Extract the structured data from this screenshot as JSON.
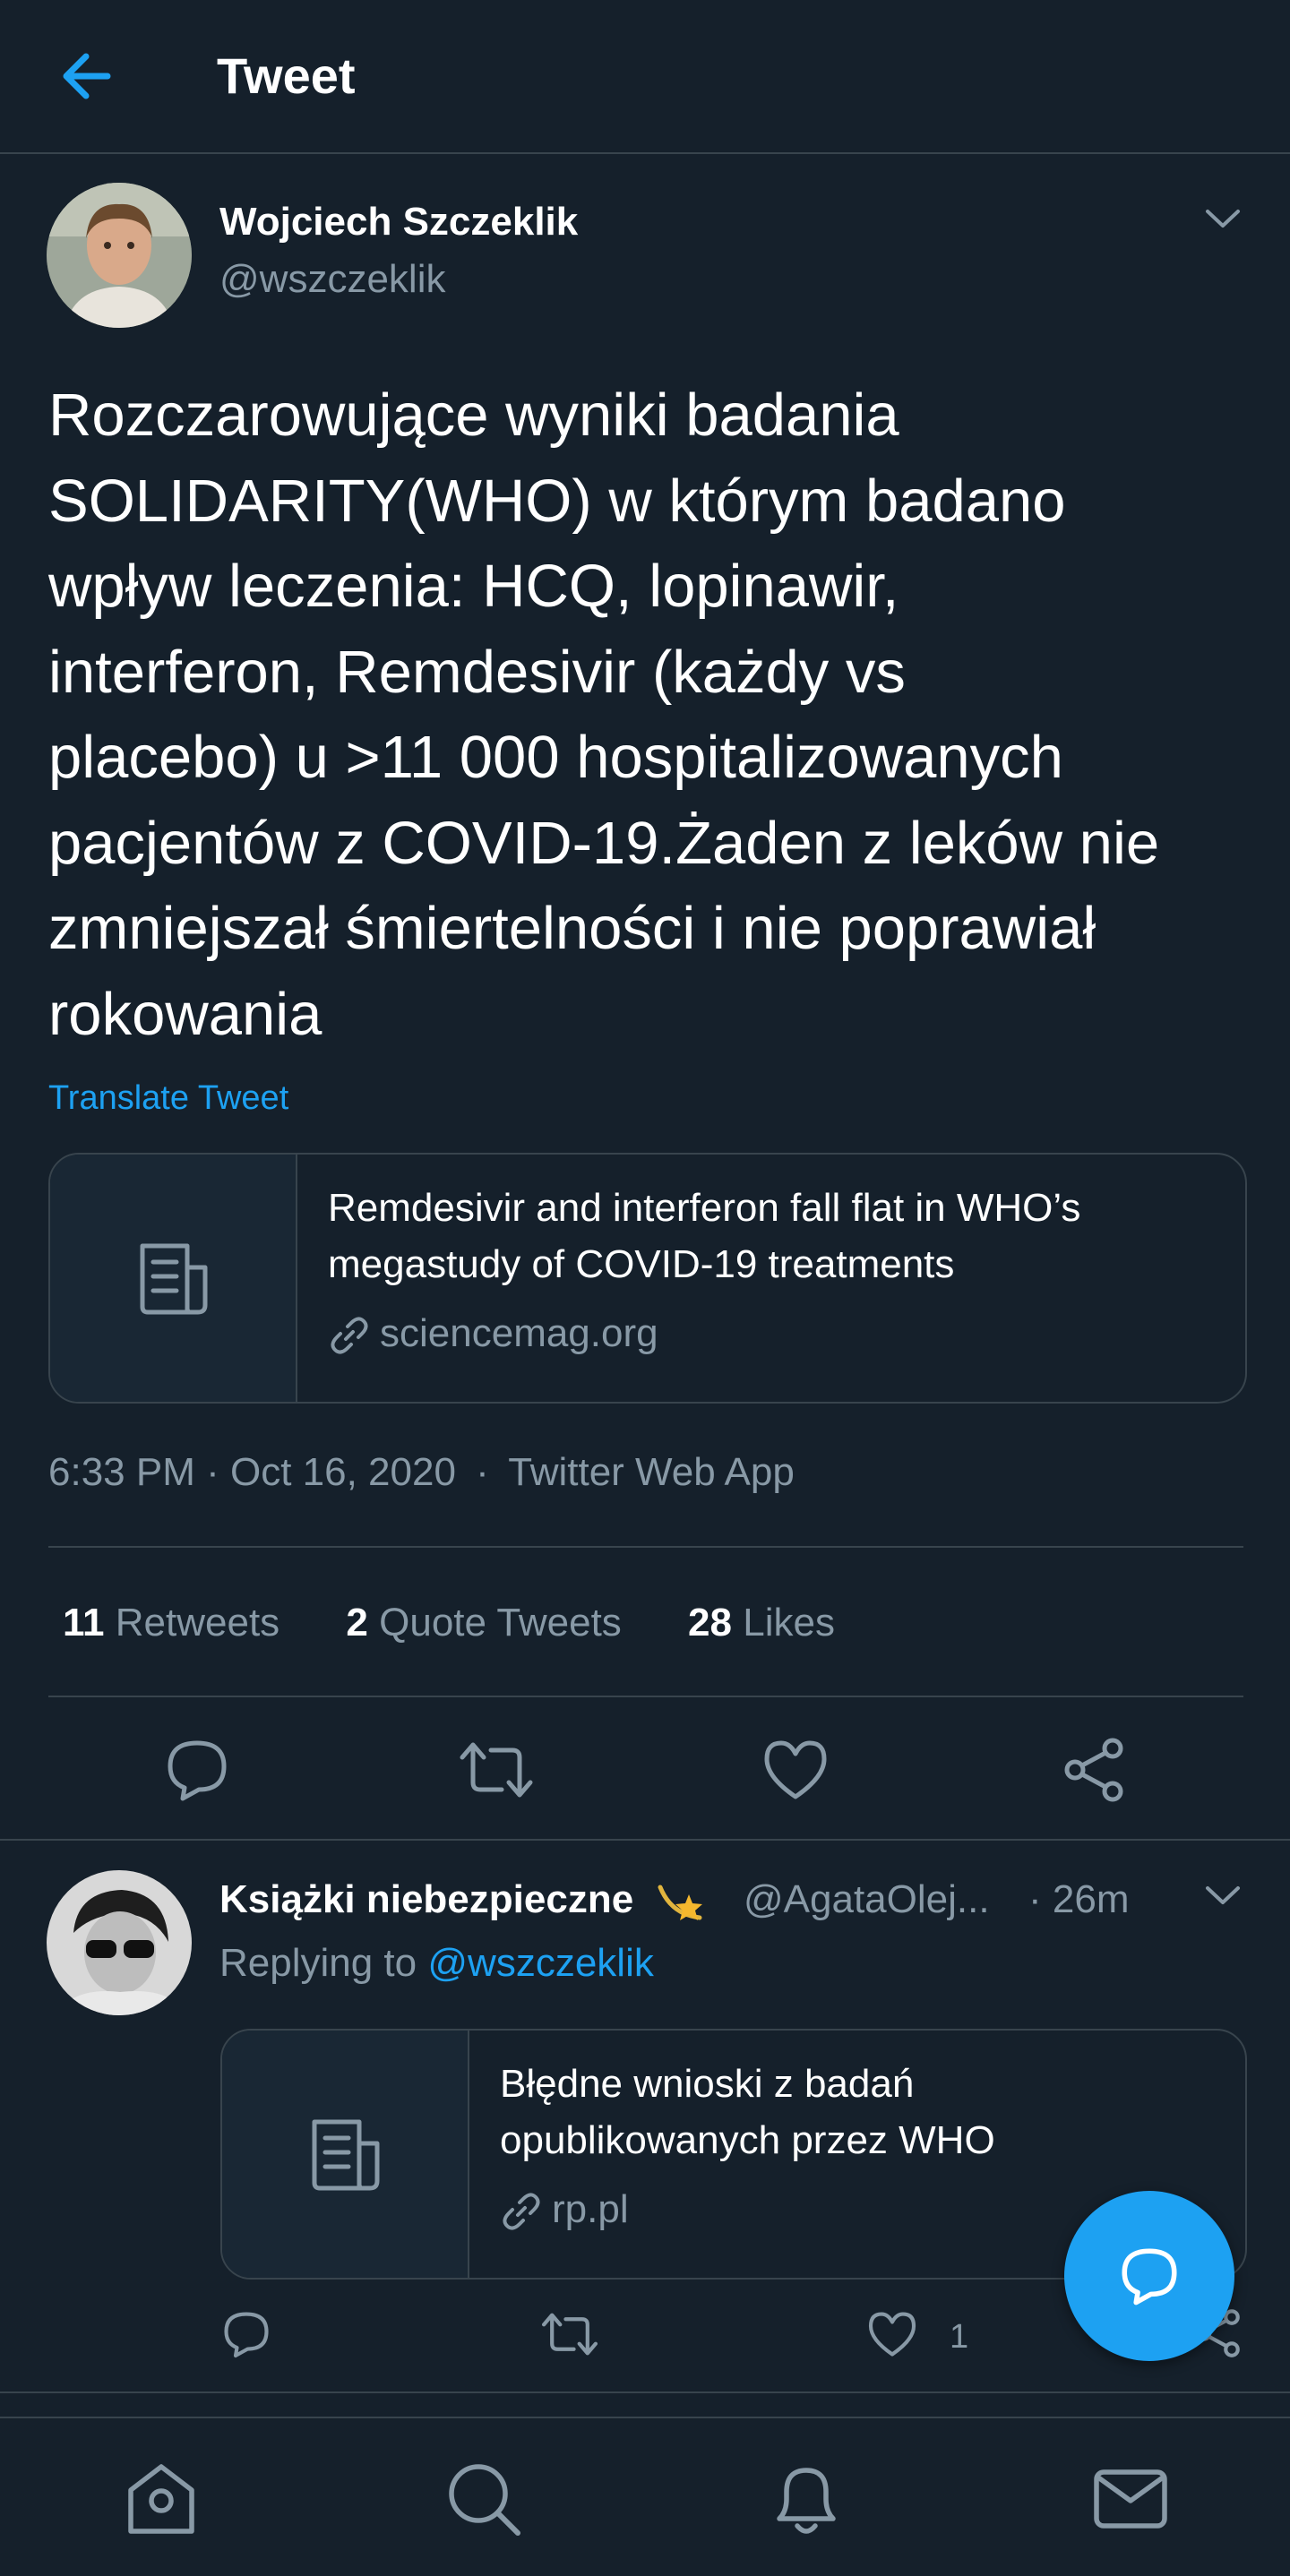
{
  "header": {
    "title": "Tweet",
    "back_icon": "arrow-left-icon",
    "accent": "#1da1f2"
  },
  "tweet": {
    "author_name": "Wojciech Szczeklik",
    "author_handle": "@wszczeklik",
    "text_lines": [
      "Rozczarowujące wyniki badania",
      "SOLIDARITY(WHO) w którym badano",
      "wpływ leczenia: HCQ, lopinawir,",
      "interferon, Remdesivir (każdy vs",
      "placebo) u >11 000 hospitalizowanych",
      "pacjentów z COVID-19.Żaden z leków nie",
      "zmniejszał śmiertelności i nie poprawiał",
      "rokowania"
    ],
    "translate_label": "Translate Tweet",
    "card": {
      "title_lines": [
        "Remdesivir and interferon fall flat in WHO’s",
        "megastudy of COVID-19 treatments"
      ],
      "domain": "sciencemag.org"
    },
    "timestamp": "6:33 PM · Oct 16, 2020",
    "separator": "·",
    "source": "Twitter Web App",
    "stats": {
      "retweets_count": "11",
      "retweets_label": "Retweets",
      "quotes_count": "2",
      "quotes_label": "Quote Tweets",
      "likes_count": "28",
      "likes_label": "Likes"
    },
    "actions": [
      "reply-icon",
      "retweet-icon",
      "heart-icon",
      "share-icon"
    ]
  },
  "reply": {
    "author_name": "Książki niebezpieczne",
    "author_handle": "@AgataOlej...",
    "time": "· 26m",
    "replying_prefix": "Replying to",
    "replying_to": "@wszczeklik",
    "card": {
      "title_lines": [
        "Błędne wnioski z badań",
        "opublikowanych przez WHO"
      ],
      "domain": "rp.pl"
    },
    "like_count": "1"
  },
  "fab": {
    "icon": "compose-reply-icon"
  },
  "bottom_nav": [
    "home-icon",
    "search-icon",
    "notifications-icon",
    "messages-icon"
  ]
}
